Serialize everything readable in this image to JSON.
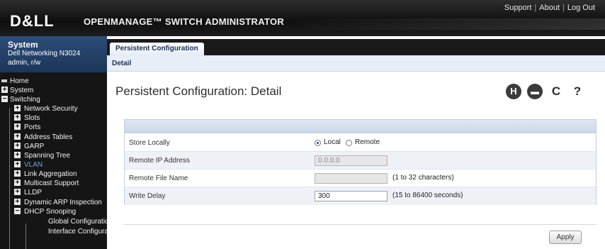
{
  "header": {
    "logo": "D&LL",
    "product": "OPENMANAGE™ SWITCH ADMINISTRATOR",
    "links": [
      "Support",
      "About",
      "Log Out"
    ]
  },
  "nav": {
    "system_title": "System",
    "device": "Dell Networking N3024",
    "user": "admin, r/w",
    "items": [
      {
        "label": "Home"
      },
      {
        "label": "System"
      },
      {
        "label": "Switching"
      },
      {
        "label": "Network Security"
      },
      {
        "label": "Slots"
      },
      {
        "label": "Ports"
      },
      {
        "label": "Address Tables"
      },
      {
        "label": "GARP"
      },
      {
        "label": "Spanning Tree"
      },
      {
        "label": "VLAN"
      },
      {
        "label": "Link Aggregation"
      },
      {
        "label": "Multicast Support"
      },
      {
        "label": "LLDP"
      },
      {
        "label": "Dynamic ARP Inspection"
      },
      {
        "label": "DHCP Snooping"
      },
      {
        "label": "Global Configuratio"
      },
      {
        "label": "Interface Configurat"
      }
    ]
  },
  "tabs": {
    "main": "Persistent Configuration",
    "sub": "Detail"
  },
  "page": {
    "title": "Persistent Configuration: Detail",
    "icons": [
      "H",
      "▬",
      "C",
      "?"
    ]
  },
  "form": {
    "store_locally_label": "Store Locally",
    "option_local": "Local",
    "option_remote": "Remote",
    "selected": "Local",
    "remote_ip_label": "Remote IP Address",
    "remote_ip_value": "0.0.0.0",
    "remote_file_label": "Remote File Name",
    "remote_file_value": "",
    "remote_file_hint": "(1 to 32 characters)",
    "write_delay_label": "Write Delay",
    "write_delay_value": "300",
    "write_delay_hint": "(15 to 86400 seconds)"
  },
  "actions": {
    "apply": "Apply"
  }
}
